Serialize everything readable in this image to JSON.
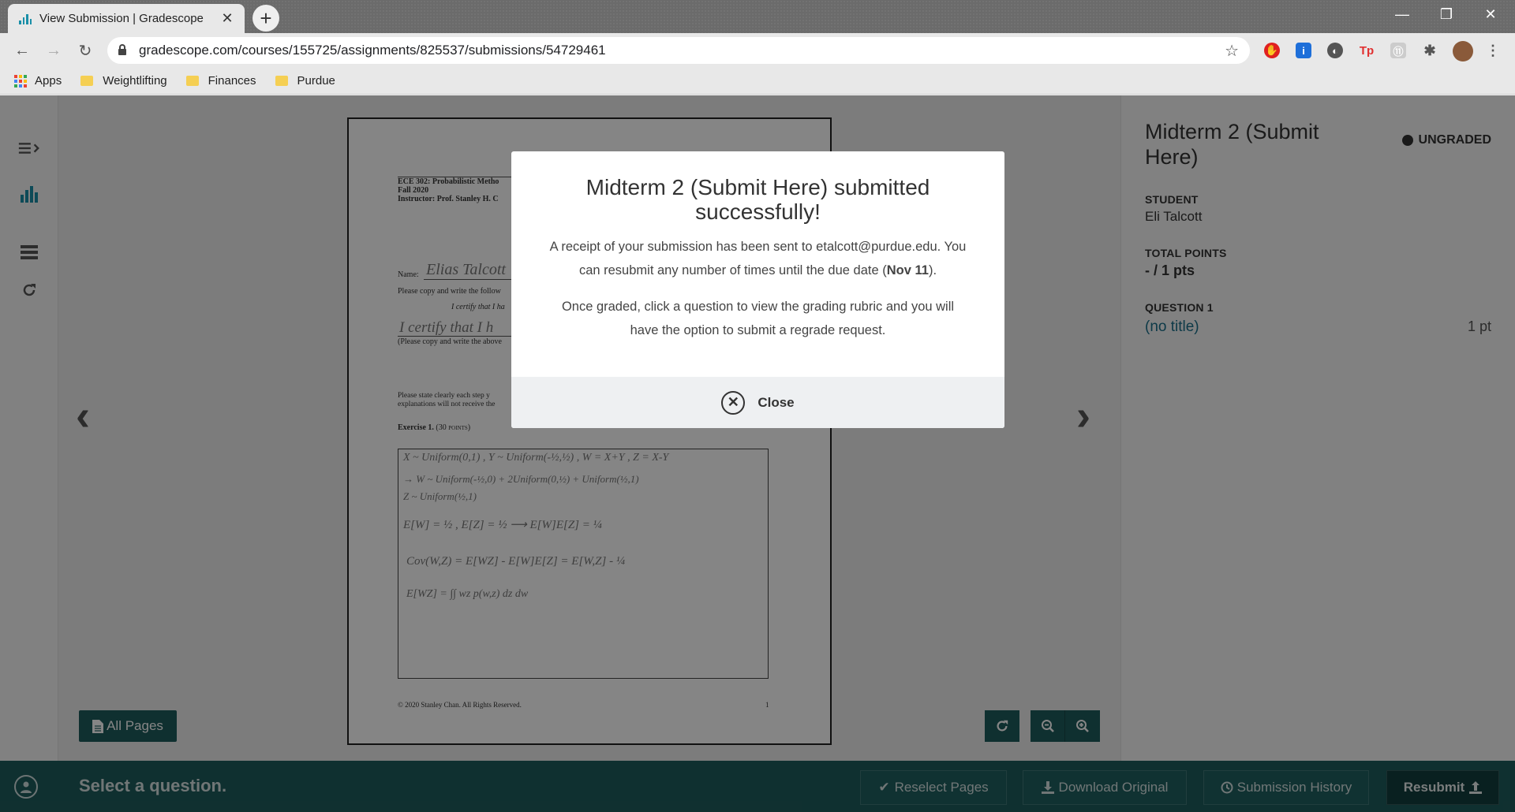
{
  "browser": {
    "tab_title": "View Submission | Gradescope",
    "tab_close": "✕",
    "new_tab": "+",
    "url": "gradescope.com/courses/155725/assignments/825537/submissions/54729461",
    "bookmarks": [
      "Apps",
      "Weightlifting",
      "Finances",
      "Purdue"
    ],
    "ext_labels": [
      "Tp",
      "⑪"
    ]
  },
  "document": {
    "header_line1": "ECE 302: Probabilistic Metho",
    "header_line2": "Fall 2020",
    "header_line3": "Instructor: Prof. Stanley H. C",
    "name_label": "Name:",
    "name_value": "Elias Talcott",
    "copy_instruction": "Please copy and write the follow",
    "certify_line": "I certify that I ha",
    "certify_handwritten": "I certify that I h",
    "copy_note": "(Please copy and write the above",
    "state_line1": "Please state clearly each step y",
    "state_line2": "explanations will not receive the",
    "exercise_label": "Exercise 1.",
    "exercise_points": "(30 points)",
    "answer_lines": [
      "X ~ Uniform(0,1) , Y ~ Uniform(-½,½) , W = X+Y , Z = X-Y",
      "→ W ~ Uniform(-½,0) + 2Uniform(0,½) + Uniform(½,1)",
      "   Z ~ Uniform(½,1)",
      "E[W] = ½ , E[Z] = ½   ⟶   E[W]E[Z] = ¼",
      "Cov(W,Z) = E[WZ] - E[W]E[Z] = E[W,Z] - ¼",
      "E[WZ] = ∫∫ wz p(w,z) dz dw"
    ],
    "footer_copyright": "© 2020 Stanley Chan. All Rights Reserved.",
    "page_number": "1"
  },
  "viewer": {
    "all_pages_label": "All Pages",
    "prev_icon": "‹",
    "next_icon": "›"
  },
  "panel": {
    "title": "Midterm 2 (Submit Here)",
    "status_badge": "UNGRADED",
    "student_label": "STUDENT",
    "student_name": "Eli Talcott",
    "total_points_label": "TOTAL POINTS",
    "total_points_value": "- / 1 pts",
    "question_label": "QUESTION 1",
    "question_title": "(no title)",
    "question_points": "1 pt"
  },
  "bottombar": {
    "prompt": "Select a question.",
    "reselect_pages": "Reselect Pages",
    "download_original": "Download Original",
    "submission_history": "Submission History",
    "resubmit": "Resubmit"
  },
  "modal": {
    "title": "Midterm 2 (Submit Here) submitted successfully!",
    "receipt_text_before": "A receipt of your submission has been sent to etalcott@purdue.edu. You can resubmit any number of times until the due date (",
    "due_date": "Nov 11",
    "receipt_text_after": ").",
    "graded_text": "Once graded, click a question to view the grading rubric and you will have the option to submit a regrade request.",
    "close_label": "Close"
  },
  "colors": {
    "brand_teal": "#1e5c5c",
    "accent_teal": "#1a8fa8"
  }
}
